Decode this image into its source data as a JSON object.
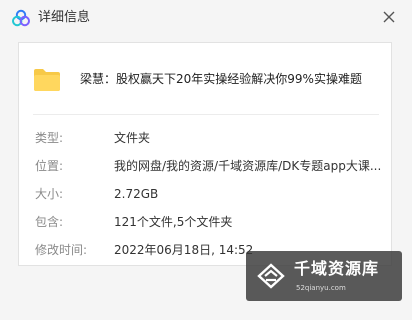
{
  "window": {
    "title": "详细信息",
    "logo_icon": "cloud-logo-icon",
    "close_icon": "close-icon"
  },
  "file": {
    "icon": "folder-icon",
    "name": "梁慧：股权赢天下20年实操经验解决你99%实操难题"
  },
  "properties": [
    {
      "label": "类型:",
      "value": "文件夹"
    },
    {
      "label": "位置:",
      "value": "我的网盘/我的资源/千域资源库/DK专题app大课..."
    },
    {
      "label": "大小:",
      "value": "2.72GB"
    },
    {
      "label": "包含:",
      "value": "121个文件,5个文件夹"
    },
    {
      "label": "修改时间:",
      "value": "2022年06月18日, 14:52"
    }
  ],
  "watermark": {
    "title": "千域资源库",
    "subtitle": "52qianyu.com"
  },
  "colors": {
    "folder": "#f7c948",
    "logo_blue": "#2f7df6",
    "logo_teal": "#23c7d3",
    "logo_purple": "#7b61ff"
  }
}
